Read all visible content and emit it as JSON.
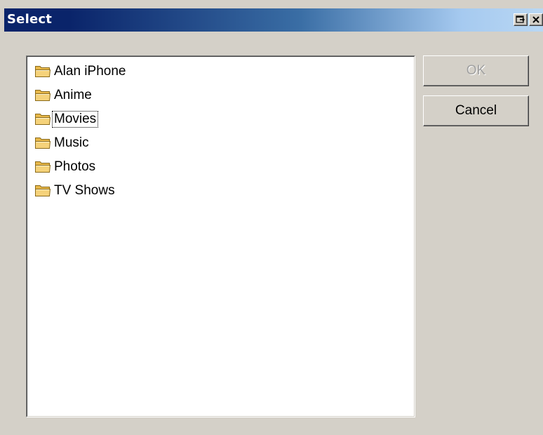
{
  "window": {
    "title": "Select"
  },
  "title_buttons": {
    "undock_icon": "undock-icon",
    "close_icon": "close-icon"
  },
  "folders": [
    {
      "label": "Alan iPhone",
      "icon": "folder-icon"
    },
    {
      "label": "Anime",
      "icon": "folder-icon"
    },
    {
      "label": "Movies",
      "icon": "folder-icon",
      "focused": true
    },
    {
      "label": "Music",
      "icon": "folder-icon"
    },
    {
      "label": "Photos",
      "icon": "folder-icon"
    },
    {
      "label": "TV Shows",
      "icon": "folder-icon"
    }
  ],
  "buttons": {
    "ok_label": "OK",
    "ok_enabled": false,
    "cancel_label": "Cancel"
  },
  "colors": {
    "titlebar_start": "#0a246a",
    "titlebar_end": "#b9d7f3",
    "dialog_background": "#d4d0c8",
    "folder_fill": "#f5d27a"
  }
}
